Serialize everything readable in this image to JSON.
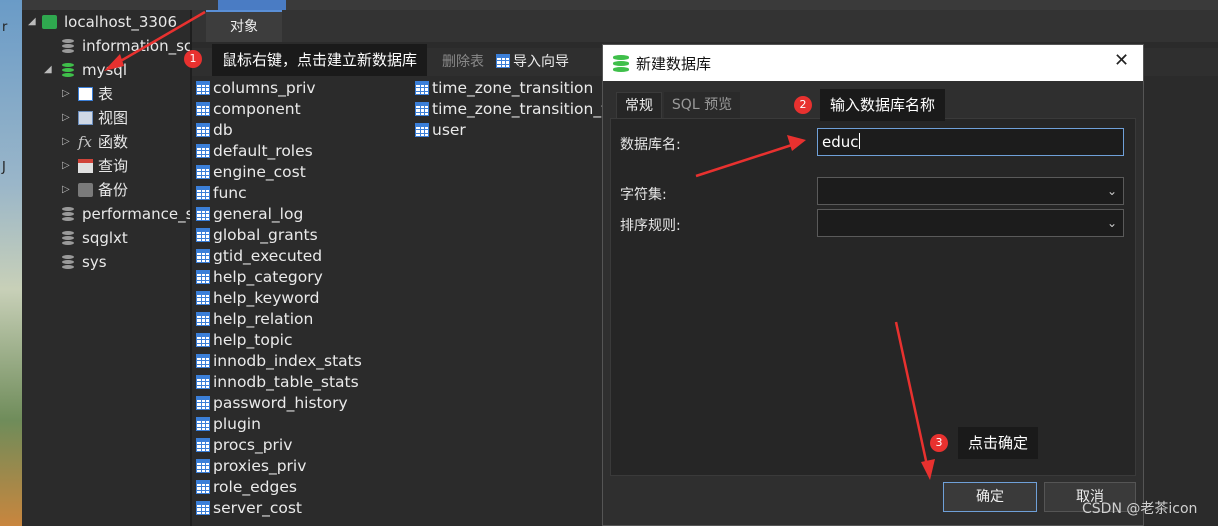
{
  "left_strip": {
    "chars": [
      "r",
      "J"
    ]
  },
  "navigator": {
    "connection": "localhost_3306",
    "databases": [
      {
        "name": "information_schema",
        "display": "information_scl"
      },
      {
        "name": "mysql",
        "display": "mysql",
        "expanded": true
      },
      {
        "name": "performance_schema",
        "display": "performance_s"
      },
      {
        "name": "sqglxt",
        "display": "sqglxt"
      },
      {
        "name": "sys",
        "display": "sys"
      }
    ],
    "mysql_children": [
      "表",
      "视图",
      "函数",
      "查询",
      "备份"
    ]
  },
  "tabs": {
    "objects": "对象"
  },
  "toolbar": {
    "delete_table": "删除表",
    "import_wizard": "导入向导"
  },
  "tables_col1": [
    "columns_priv",
    "component",
    "db",
    "default_roles",
    "engine_cost",
    "func",
    "general_log",
    "global_grants",
    "gtid_executed",
    "help_category",
    "help_keyword",
    "help_relation",
    "help_topic",
    "innodb_index_stats",
    "innodb_table_stats",
    "password_history",
    "plugin",
    "procs_priv",
    "proxies_priv",
    "role_edges",
    "server_cost"
  ],
  "tables_col2": [
    "time_zone_transition",
    "time_zone_transition_ty",
    "user"
  ],
  "dialog": {
    "title": "新建数据库",
    "close": "✕",
    "tabs": [
      "常规",
      "SQL 预览"
    ],
    "fields": {
      "db_name_label": "数据库名:",
      "db_name_value": "educ",
      "charset_label": "字符集:",
      "charset_value": "",
      "collation_label": "排序规则:",
      "collation_value": ""
    },
    "ok": "确定",
    "cancel": "取消"
  },
  "callouts": [
    {
      "num": "1",
      "text": "鼠标右键，点击建立新数据库"
    },
    {
      "num": "2",
      "text": "输入数据库名称"
    },
    {
      "num": "3",
      "text": "点击确定"
    }
  ],
  "watermark": "CSDN @老茶icon",
  "colors": {
    "accent": "#4a7cc4",
    "badge": "#e8312f",
    "arrow": "#e8312f",
    "db_green": "#3fbf4a"
  }
}
